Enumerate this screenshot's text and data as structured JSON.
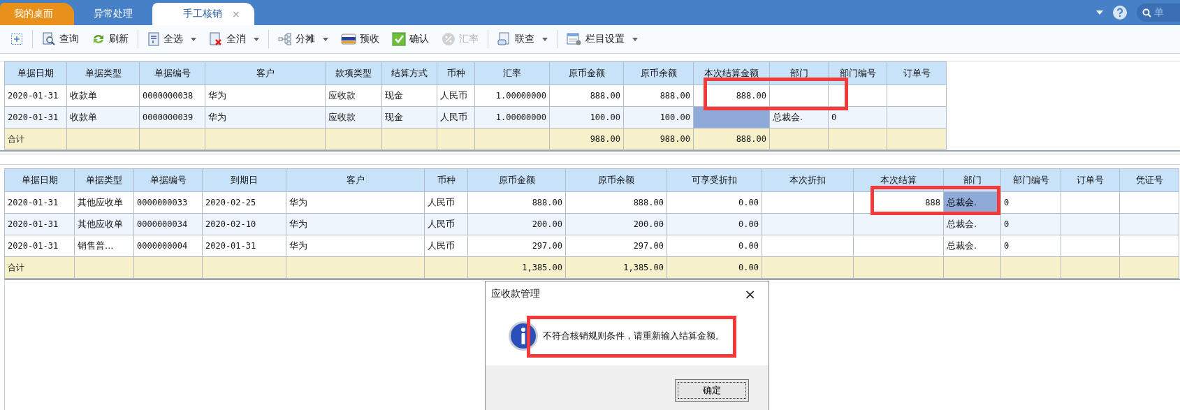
{
  "tabs": [
    {
      "label": "我的桌面",
      "kind": "home",
      "selected": false
    },
    {
      "label": "异常处理",
      "kind": "page",
      "selected": false
    },
    {
      "label": "手工核销",
      "kind": "page",
      "selected": true,
      "close": "×"
    }
  ],
  "search": {
    "placeholder": "单"
  },
  "toolbar": [
    {
      "kind": "add"
    },
    {
      "kind": "separator"
    },
    {
      "kind": "query",
      "label": "查询",
      "dropdown": false,
      "disabled": false
    },
    {
      "kind": "refresh",
      "label": "刷新",
      "dropdown": false,
      "disabled": false
    },
    {
      "kind": "separator"
    },
    {
      "kind": "selectall",
      "label": "全选",
      "dropdown": true,
      "disabled": false
    },
    {
      "kind": "deselect",
      "label": "全消",
      "dropdown": true,
      "disabled": false
    },
    {
      "kind": "separator"
    },
    {
      "kind": "split",
      "label": "分摊",
      "dropdown": true,
      "disabled": false
    },
    {
      "kind": "card",
      "label": "预收",
      "dropdown": false,
      "disabled": false
    },
    {
      "kind": "check",
      "label": "确认",
      "dropdown": false,
      "disabled": false
    },
    {
      "kind": "percent",
      "label": "汇率",
      "dropdown": false,
      "disabled": true
    },
    {
      "kind": "separator"
    },
    {
      "kind": "link",
      "label": "联查",
      "dropdown": true,
      "disabled": false
    },
    {
      "kind": "separator"
    },
    {
      "kind": "columns",
      "label": "栏目设置",
      "dropdown": true,
      "disabled": false
    }
  ],
  "receipts_table": {
    "columns": [
      "单据日期",
      "单据类型",
      "单据编号",
      "客户",
      "款项类型",
      "结算方式",
      "币种",
      "汇率",
      "原币金额",
      "原币余额",
      "本次结算金额",
      "部门",
      "部门编号",
      "订单号"
    ],
    "rows": [
      {
        "kind": "data",
        "cells": [
          {
            "text": "2020-01-31",
            "selected": false
          },
          {
            "text": "收款单",
            "selected": false
          },
          {
            "text": "0000000038",
            "selected": false
          },
          {
            "text": "华为",
            "selected": false
          },
          {
            "text": "应收款",
            "selected": false
          },
          {
            "text": "现金",
            "selected": false
          },
          {
            "text": "人民币",
            "selected": false
          },
          {
            "text": "1.00000000",
            "selected": false
          },
          {
            "text": "888.00",
            "selected": false
          },
          {
            "text": "888.00",
            "selected": false
          },
          {
            "text": "888.00",
            "selected": false
          },
          {
            "selected": false
          },
          {
            "selected": false
          },
          {
            "selected": false
          }
        ]
      },
      {
        "kind": "data",
        "cells": [
          {
            "text": "2020-01-31",
            "selected": false
          },
          {
            "text": "收款单",
            "selected": false
          },
          {
            "text": "0000000039",
            "selected": false
          },
          {
            "text": "华为",
            "selected": false
          },
          {
            "text": "应收款",
            "selected": false
          },
          {
            "text": "现金",
            "selected": false
          },
          {
            "text": "人民币",
            "selected": false
          },
          {
            "text": "1.00000000",
            "selected": false
          },
          {
            "text": "100.00",
            "selected": false
          },
          {
            "text": "100.00",
            "selected": false
          },
          {
            "selected": true
          },
          {
            "text": "总裁会.",
            "selected": false
          },
          {
            "text": "0",
            "selected": false
          },
          {
            "selected": false
          }
        ]
      },
      {
        "kind": "total",
        "cells": [
          {
            "text": "合计",
            "selected": false
          },
          {
            "selected": false
          },
          {
            "selected": false
          },
          {
            "selected": false
          },
          {
            "selected": false
          },
          {
            "selected": false
          },
          {
            "selected": false
          },
          {
            "selected": false
          },
          {
            "text": "988.00",
            "selected": false
          },
          {
            "text": "988.00",
            "selected": false
          },
          {
            "text": "888.00",
            "selected": false
          },
          {
            "selected": false
          },
          {
            "selected": false
          },
          {
            "selected": false
          }
        ]
      }
    ]
  },
  "bills_table": {
    "columns": [
      "单据日期",
      "单据类型",
      "单据编号",
      "到期日",
      "客户",
      "币种",
      "原币金额",
      "原币余额",
      "可享受折扣",
      "本次折扣",
      "本次结算",
      "部门",
      "部门编号",
      "订单号",
      "凭证号"
    ],
    "rows": [
      {
        "kind": "data",
        "cells": [
          {
            "text": "2020-01-31",
            "selected": false
          },
          {
            "text": "其他应收单",
            "selected": false
          },
          {
            "text": "0000000033",
            "selected": false
          },
          {
            "text": "2020-02-25",
            "selected": false
          },
          {
            "text": "华为",
            "selected": false
          },
          {
            "text": "人民币",
            "selected": false
          },
          {
            "text": "888.00",
            "selected": false
          },
          {
            "text": "888.00",
            "selected": false
          },
          {
            "text": "0.00",
            "selected": false
          },
          {
            "selected": false
          },
          {
            "text": "888",
            "selected": false
          },
          {
            "text": "总裁会.",
            "selected": true
          },
          {
            "text": "0",
            "selected": false
          },
          {
            "selected": false
          },
          {
            "selected": false
          }
        ]
      },
      {
        "kind": "data",
        "cells": [
          {
            "text": "2020-01-31",
            "selected": false
          },
          {
            "text": "其他应收单",
            "selected": false
          },
          {
            "text": "0000000034",
            "selected": false
          },
          {
            "text": "2020-02-10",
            "selected": false
          },
          {
            "text": "华为",
            "selected": false
          },
          {
            "text": "人民币",
            "selected": false
          },
          {
            "text": "200.00",
            "selected": false
          },
          {
            "text": "200.00",
            "selected": false
          },
          {
            "text": "0.00",
            "selected": false
          },
          {
            "selected": false
          },
          {
            "selected": false
          },
          {
            "text": "总裁会.",
            "selected": false
          },
          {
            "text": "0",
            "selected": false
          },
          {
            "selected": false
          },
          {
            "selected": false
          }
        ]
      },
      {
        "kind": "data",
        "cells": [
          {
            "text": "2020-01-31",
            "selected": false
          },
          {
            "text": "销售普...",
            "selected": false
          },
          {
            "text": "0000000004",
            "selected": false
          },
          {
            "text": "2020-01-31",
            "selected": false
          },
          {
            "text": "华为",
            "selected": false
          },
          {
            "text": "人民币",
            "selected": false
          },
          {
            "text": "297.00",
            "selected": false
          },
          {
            "text": "297.00",
            "selected": false
          },
          {
            "text": "0.00",
            "selected": false
          },
          {
            "selected": false
          },
          {
            "selected": false
          },
          {
            "text": "总裁会.",
            "selected": false
          },
          {
            "text": "0",
            "selected": false
          },
          {
            "selected": false
          },
          {
            "selected": false
          }
        ]
      },
      {
        "kind": "total",
        "cells": [
          {
            "text": "合计",
            "selected": false
          },
          {
            "selected": false
          },
          {
            "selected": false
          },
          {
            "selected": false
          },
          {
            "selected": false
          },
          {
            "selected": false
          },
          {
            "text": "1,385.00",
            "selected": false
          },
          {
            "text": "1,385.00",
            "selected": false
          },
          {
            "text": "0.00",
            "selected": false
          },
          {
            "selected": false
          },
          {
            "selected": false
          },
          {
            "selected": false
          },
          {
            "selected": false
          },
          {
            "selected": false
          },
          {
            "selected": false
          }
        ]
      }
    ]
  },
  "dialog": {
    "title": "应收款管理",
    "close": "×",
    "message": "不符合核销规则条件，请重新输入结算金额。",
    "button": "确定"
  }
}
